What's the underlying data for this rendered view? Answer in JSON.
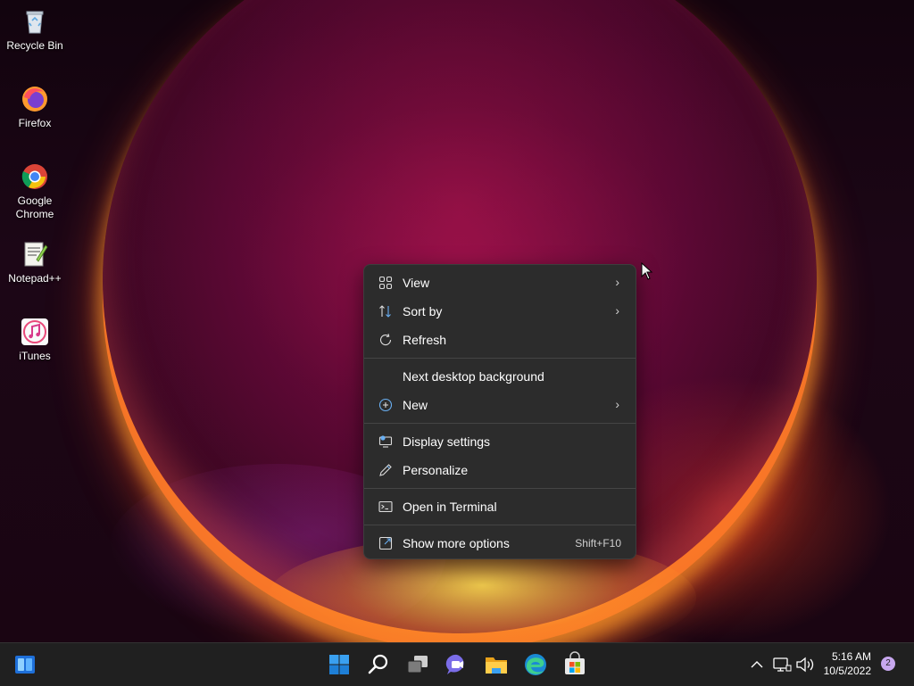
{
  "desktop": {
    "icons": [
      {
        "label": "Recycle Bin",
        "icon": "recycle-bin-icon"
      },
      {
        "label": "Firefox",
        "icon": "firefox-icon"
      },
      {
        "label": "Google Chrome",
        "icon": "chrome-icon"
      },
      {
        "label": "Notepad++",
        "icon": "notepad-plus-plus-icon"
      },
      {
        "label": "iTunes",
        "icon": "itunes-icon"
      }
    ]
  },
  "context_menu": {
    "items": [
      {
        "label": "View",
        "icon": "view-grid-icon",
        "submenu": true
      },
      {
        "label": "Sort by",
        "icon": "sort-icon",
        "submenu": true
      },
      {
        "label": "Refresh",
        "icon": "refresh-icon",
        "submenu": false
      },
      {
        "label": "Next desktop background",
        "icon": "",
        "submenu": false
      },
      {
        "label": "New",
        "icon": "new-plus-icon",
        "submenu": true
      },
      {
        "label": "Display settings",
        "icon": "display-settings-icon",
        "submenu": false
      },
      {
        "label": "Personalize",
        "icon": "pen-icon",
        "submenu": false
      },
      {
        "label": "Open in Terminal",
        "icon": "terminal-icon",
        "submenu": false
      },
      {
        "label": "Show more options",
        "icon": "more-options-icon",
        "submenu": false,
        "shortcut": "Shift+F10"
      }
    ],
    "submenu_arrow": "›"
  },
  "taskbar": {
    "apps": [
      "widgets-icon",
      "start-icon",
      "search-icon",
      "task-view-icon",
      "chat-icon",
      "file-explorer-icon",
      "edge-icon",
      "store-icon"
    ],
    "tray": {
      "chevron": "^",
      "time": "5:16 AM",
      "date": "10/5/2022",
      "notification_count": "2"
    }
  },
  "colors": {
    "menu_bg": "#2c2c2c",
    "taskbar_bg": "#202020",
    "accent": "#0078d4",
    "notification_badge": "#c7a7ee"
  }
}
